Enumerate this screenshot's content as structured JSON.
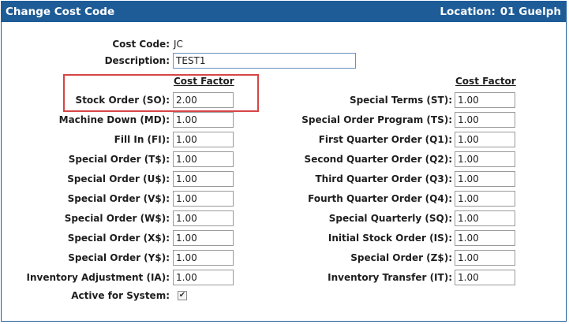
{
  "header": {
    "title": "Change Cost Code",
    "location_label": "Location:",
    "location_value": "01 Guelph"
  },
  "cost_code": {
    "label": "Cost Code:",
    "value": "JC"
  },
  "description": {
    "label": "Description:",
    "value": "TEST1"
  },
  "column_header": "Cost Factor",
  "left_rows": [
    {
      "label": "Stock Order (SO):",
      "value": "2.00"
    },
    {
      "label": "Machine Down (MD):",
      "value": "1.00"
    },
    {
      "label": "Fill In (FI):",
      "value": "1.00"
    },
    {
      "label": "Special Order (T$):",
      "value": "1.00"
    },
    {
      "label": "Special Order (U$):",
      "value": "1.00"
    },
    {
      "label": "Special Order (V$):",
      "value": "1.00"
    },
    {
      "label": "Special Order (W$):",
      "value": "1.00"
    },
    {
      "label": "Special Order (X$):",
      "value": "1.00"
    },
    {
      "label": "Special Order (Y$):",
      "value": "1.00"
    },
    {
      "label": "Inventory Adjustment (IA):",
      "value": "1.00"
    }
  ],
  "right_rows": [
    {
      "label": "Special Terms (ST):",
      "value": "1.00"
    },
    {
      "label": "Special Order Program (TS):",
      "value": "1.00"
    },
    {
      "label": "First Quarter Order (Q1):",
      "value": "1.00"
    },
    {
      "label": "Second Quarter Order (Q2):",
      "value": "1.00"
    },
    {
      "label": "Third Quarter Order (Q3):",
      "value": "1.00"
    },
    {
      "label": "Fourth Quarter Order (Q4):",
      "value": "1.00"
    },
    {
      "label": "Special Quarterly (SQ):",
      "value": "1.00"
    },
    {
      "label": "Initial Stock Order (IS):",
      "value": "1.00"
    },
    {
      "label": "Special Order (Z$):",
      "value": "1.00"
    },
    {
      "label": "Inventory Transfer (IT):",
      "value": "1.00"
    }
  ],
  "active": {
    "label": "Active for System:",
    "checked": true,
    "mark": "✔"
  }
}
